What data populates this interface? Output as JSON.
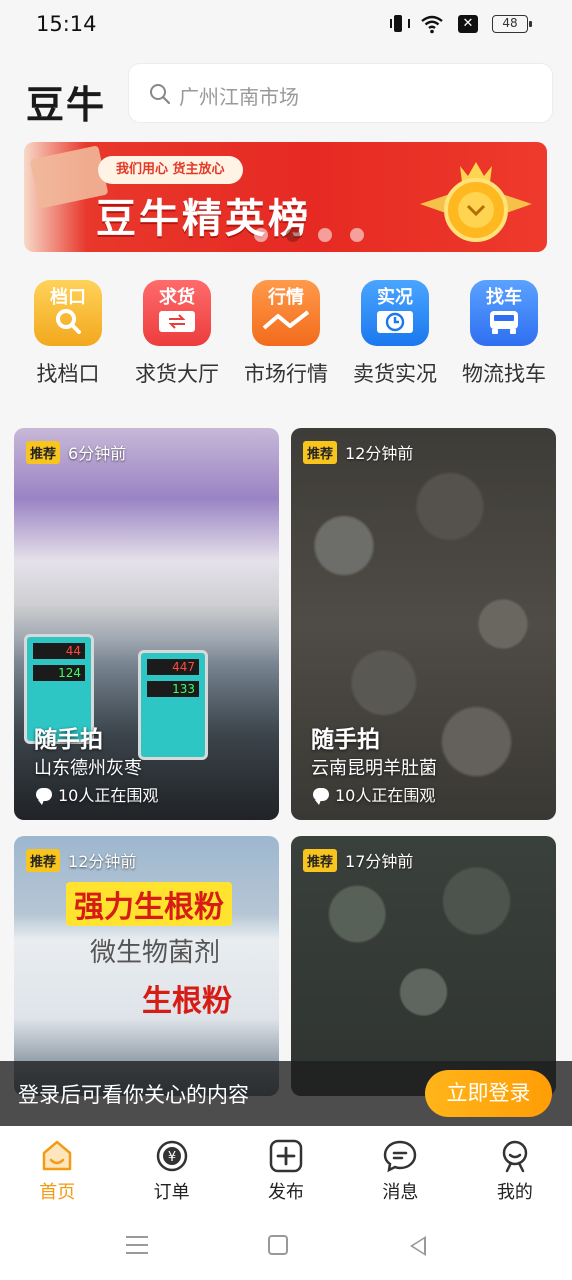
{
  "status": {
    "time": "15:14",
    "battery": "48"
  },
  "header": {
    "logo": "豆牛",
    "search_placeholder": "广州江南市场"
  },
  "banner": {
    "tag": "我们用心 货主放心",
    "title": "豆牛精英榜",
    "dots": 4,
    "active_dot": 1
  },
  "quicknav": [
    {
      "label": "找档口",
      "icon_word": "档口",
      "icon": "stall-search-icon"
    },
    {
      "label": "求货大厅",
      "icon_word": "求货",
      "icon": "exchange-icon"
    },
    {
      "label": "市场行情",
      "icon_word": "行情",
      "icon": "trend-chart-icon"
    },
    {
      "label": "卖货实况",
      "icon_word": "实况",
      "icon": "clock-icon"
    },
    {
      "label": "物流找车",
      "icon_word": "找车",
      "icon": "truck-icon"
    }
  ],
  "feed": [
    {
      "badge": "推荐",
      "time": "6分钟前",
      "title": "随手拍",
      "subtitle": "山东德州灰枣",
      "watching": "10人正在围观",
      "scale_a": "44",
      "scale_b": "124",
      "scale_c": "447",
      "scale_d": "133"
    },
    {
      "badge": "推荐",
      "time": "12分钟前",
      "title": "随手拍",
      "subtitle": "云南昆明羊肚菌",
      "watching": "10人正在围观"
    },
    {
      "badge": "推荐",
      "time": "12分钟前",
      "bag_title": "强力生根粉",
      "bag_sub1": "微生物菌剂",
      "bag_sub2": "生根粉"
    },
    {
      "badge": "推荐",
      "time": "17分钟前"
    }
  ],
  "login_bar": {
    "text": "登录后可看你关心的内容",
    "button": "立即登录"
  },
  "tabs": [
    {
      "label": "首页",
      "active": true
    },
    {
      "label": "订单",
      "active": false
    },
    {
      "label": "发布",
      "active": false
    },
    {
      "label": "消息",
      "active": false
    },
    {
      "label": "我的",
      "active": false
    }
  ],
  "colors": {
    "accent": "#f29b14",
    "banner_red": "#e62a23",
    "badge_yellow": "#f7c51d"
  }
}
